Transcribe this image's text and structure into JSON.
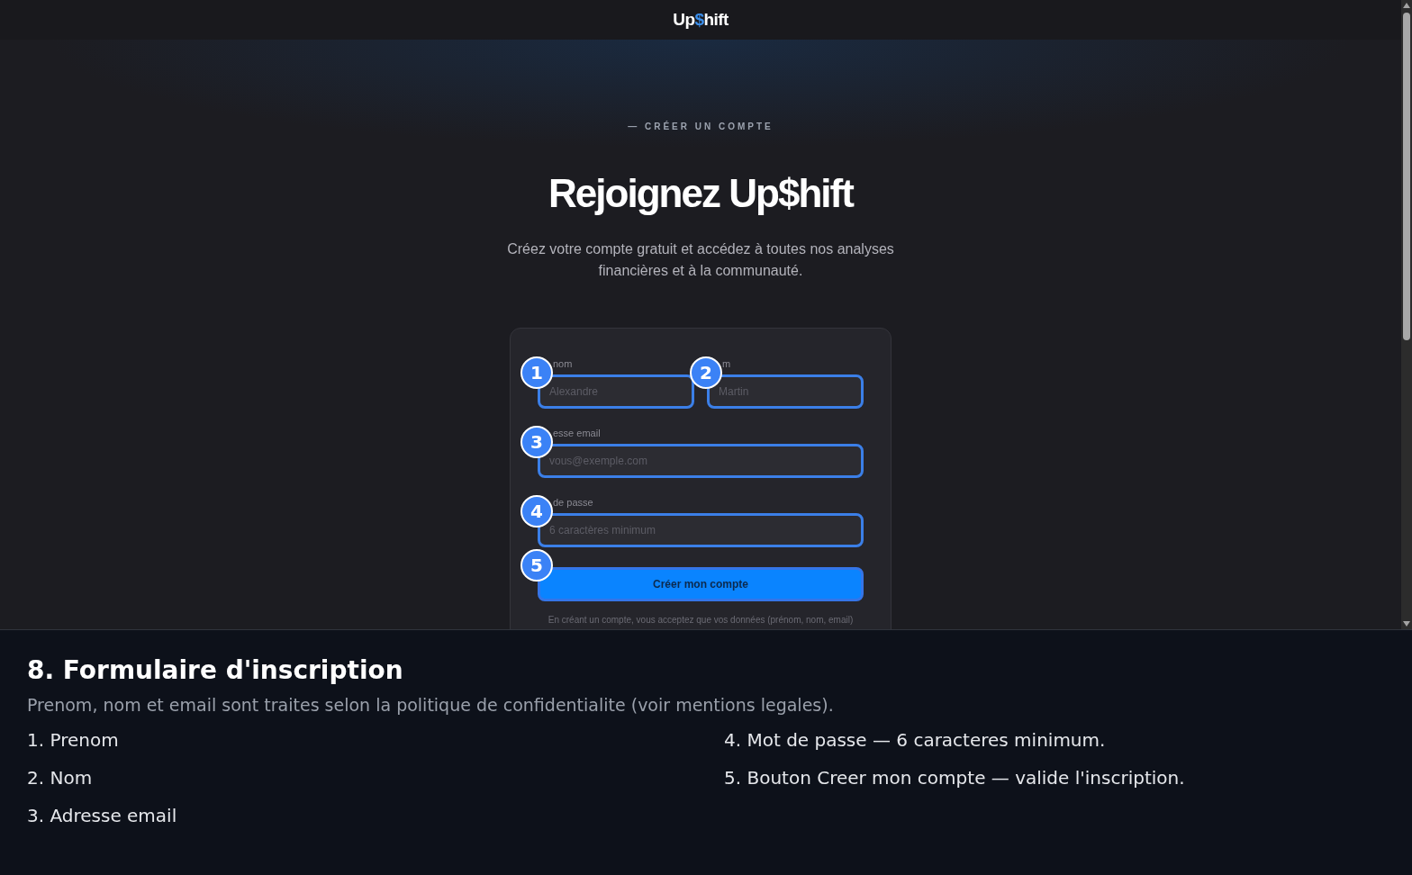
{
  "nav": {
    "logo": [
      {
        "text": "Up",
        "accent": false
      },
      {
        "text": "$",
        "accent": true
      },
      {
        "text": "hift",
        "accent": false
      }
    ]
  },
  "hero": {
    "eyebrow": "— CRÉER UN COMPTE",
    "title": "Rejoignez Up$hift",
    "subtitle": "Créez votre compte gratuit et accédez à toutes nos analyses financières et à la communauté."
  },
  "form": {
    "rows": [
      {
        "fields": [
          {
            "label": "nom",
            "placeholder": "Alexandre",
            "marker": "1",
            "highlighted": true
          },
          {
            "label": "m",
            "placeholder": "Martin",
            "marker": "2",
            "highlighted": true
          }
        ]
      },
      {
        "fields": [
          {
            "label": "esse email",
            "placeholder": "vous@exemple.com",
            "marker": "3",
            "highlighted": true
          }
        ]
      },
      {
        "fields": [
          {
            "label": "de passe",
            "placeholder": "6 caractères minimum",
            "marker": "4",
            "highlighted": true
          }
        ]
      }
    ],
    "submit": {
      "label": "Créer mon compte",
      "marker": "5",
      "highlighted": true
    },
    "notice": "En créant un compte, vous acceptez que vos données (prénom, nom, email)"
  },
  "caption": {
    "title": "8. Formulaire d'inscription",
    "description": "Prenom, nom et email sont traites selon la politique de confidentialite (voir mentions legales).",
    "items": [
      "1. Prenom",
      "2. Nom",
      "3. Adresse email",
      "4. Mot de passe — 6 caracteres minimum.",
      "5. Bouton Creer mon compte — valide l'inscription."
    ]
  }
}
